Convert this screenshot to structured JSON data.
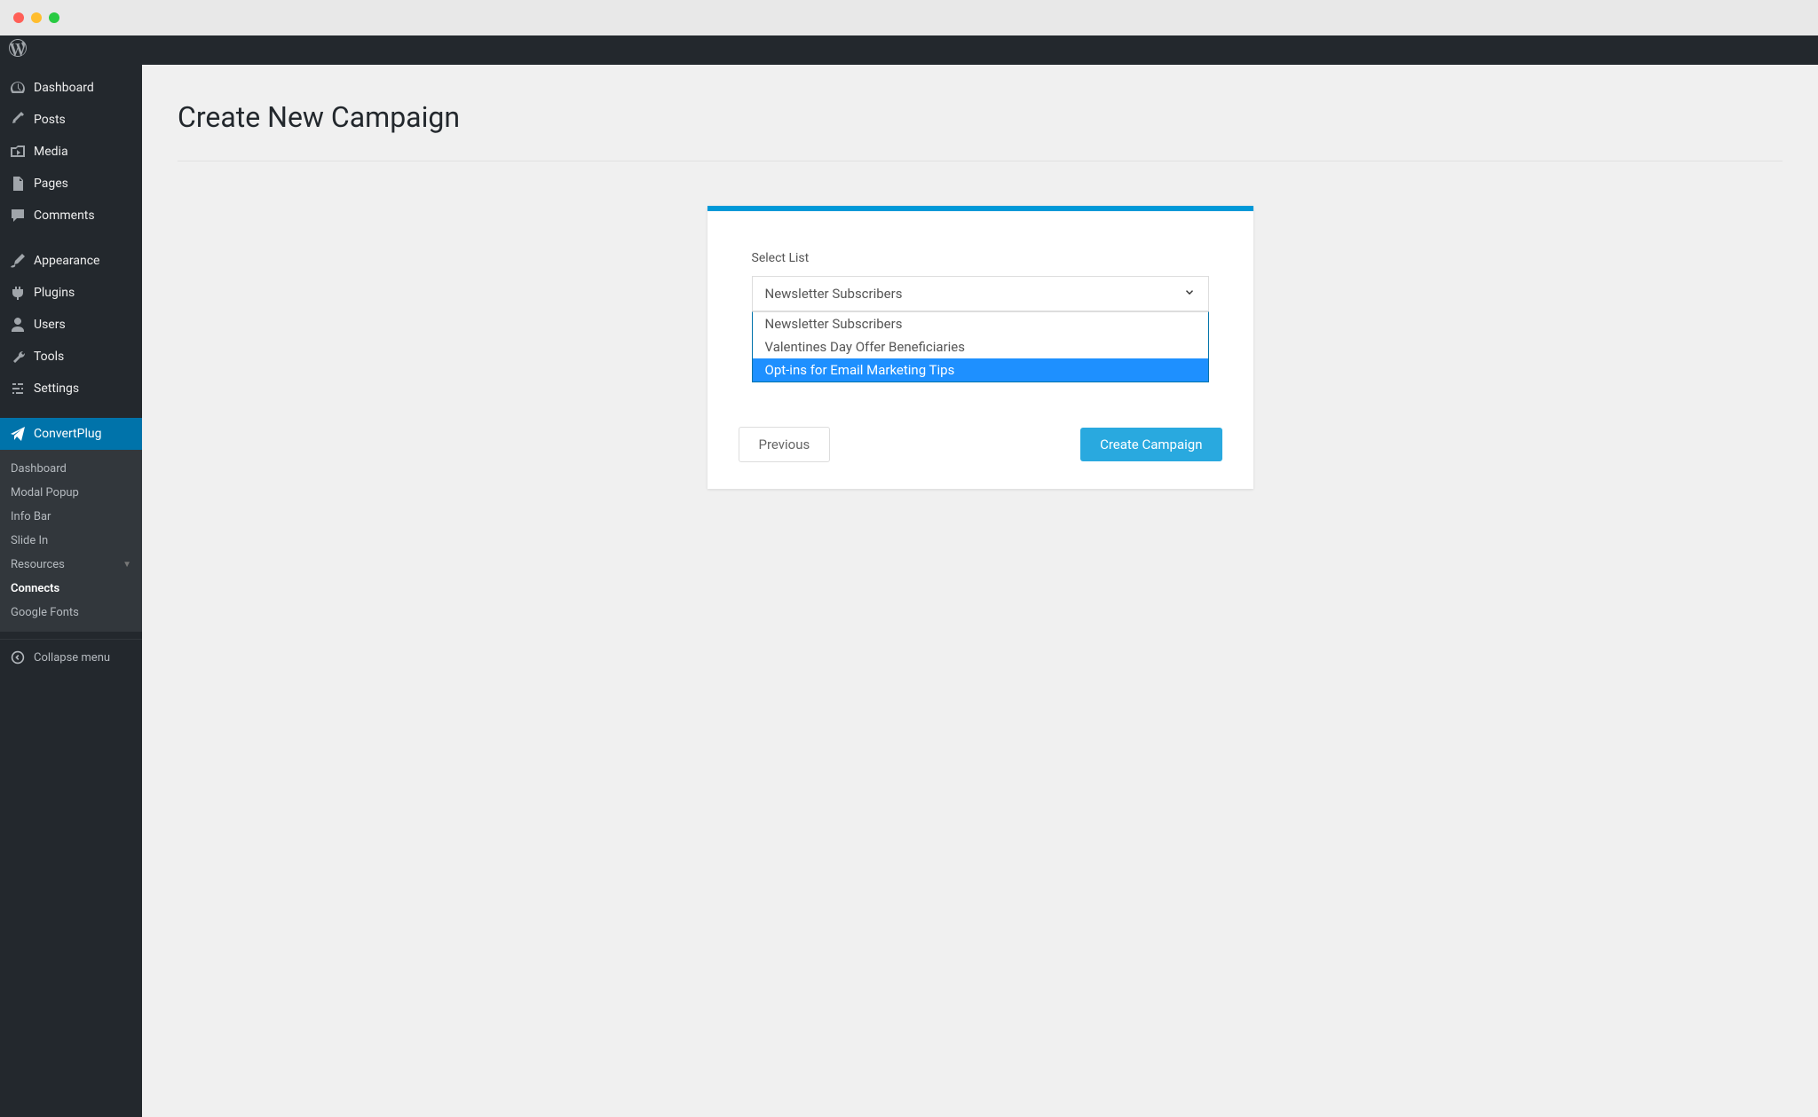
{
  "sidebar": {
    "main_items": [
      {
        "icon": "dashboard",
        "label": "Dashboard"
      },
      {
        "icon": "pin",
        "label": "Posts"
      },
      {
        "icon": "media",
        "label": "Media"
      },
      {
        "icon": "page",
        "label": "Pages"
      },
      {
        "icon": "comment",
        "label": "Comments"
      }
    ],
    "admin_items": [
      {
        "icon": "brush",
        "label": "Appearance"
      },
      {
        "icon": "plug",
        "label": "Plugins"
      },
      {
        "icon": "user",
        "label": "Users"
      },
      {
        "icon": "wrench",
        "label": "Tools"
      },
      {
        "icon": "sliders",
        "label": "Settings"
      }
    ],
    "active_item": {
      "icon": "send",
      "label": "ConvertPlug"
    },
    "submenu": [
      {
        "label": "Dashboard",
        "bold": false
      },
      {
        "label": "Modal Popup",
        "bold": false
      },
      {
        "label": "Info Bar",
        "bold": false
      },
      {
        "label": "Slide In",
        "bold": false
      },
      {
        "label": "Resources",
        "bold": false,
        "chevron": true
      },
      {
        "label": "Connects",
        "bold": true
      },
      {
        "label": "Google Fonts",
        "bold": false
      }
    ],
    "collapse_label": "Collapse menu"
  },
  "page": {
    "title": "Create New Campaign"
  },
  "form": {
    "label": "Select List",
    "selected_value": "Newsletter Subscribers",
    "options": [
      {
        "label": "Newsletter Subscribers",
        "highlighted": false
      },
      {
        "label": "Valentines Day Offer Beneficiaries",
        "highlighted": false
      },
      {
        "label": "Opt-ins for Email Marketing Tips",
        "highlighted": true
      }
    ]
  },
  "buttons": {
    "previous": "Previous",
    "create": "Create Campaign"
  }
}
